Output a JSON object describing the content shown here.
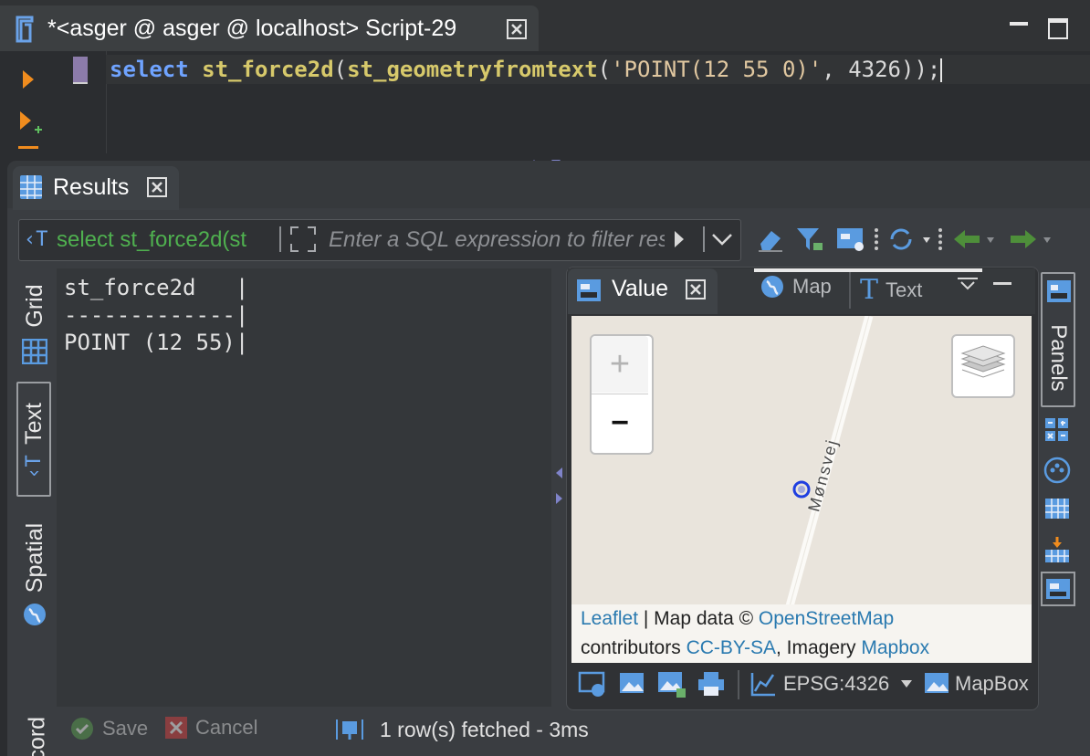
{
  "editor": {
    "tab_title": "*<asger @ asger @ localhost> Script-29",
    "code": {
      "kw": "select",
      "fn1": "st_force2d",
      "p1": "(",
      "fn2": "st_geometryfromtext",
      "p2": "(",
      "str": "'POINT(12 55 0)'",
      "p3": ", ",
      "num": "4326",
      "p4": "));"
    }
  },
  "results": {
    "tab_title": "Results",
    "filter_query": "select st_force2d(st",
    "filter_placeholder": "Enter a SQL expression to filter results"
  },
  "side_tabs": {
    "grid": "Grid",
    "text": "Text",
    "spatial": "Spatial",
    "record": "Record"
  },
  "text_output": {
    "header": "st_force2d   |",
    "separator": "-------------|",
    "row": "POINT (12 55)|"
  },
  "value_panel": {
    "tab_title": "Value",
    "map_tab": "Map",
    "text_tab": "Text"
  },
  "map": {
    "street_label": "Mønsvej",
    "zoom_in": "+",
    "zoom_out": "−",
    "attribution": {
      "leaflet": "Leaflet",
      "sep": " | Map data © ",
      "osm": "OpenStreetMap",
      "contributors": "contributors ",
      "license": "CC-BY-SA",
      "imagery": ", Imagery ",
      "mapbox": "Mapbox"
    },
    "point_color": "#1f3fe0"
  },
  "map_toolbar": {
    "crs": "EPSG:4326",
    "basemap": "MapBox"
  },
  "right_strip": {
    "panels_label": "Panels"
  },
  "status": {
    "save": "Save",
    "cancel": "Cancel",
    "fetched": "1 row(s) fetched - 3ms"
  }
}
